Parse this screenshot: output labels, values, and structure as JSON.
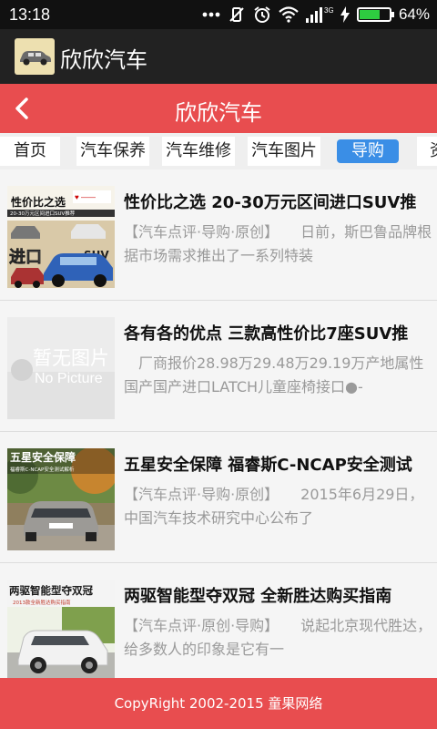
{
  "status_bar": {
    "time": "13:18",
    "network": "3G",
    "battery_percent": "64%",
    "battery_level": 0.64
  },
  "app": {
    "title": "欣欣汽车",
    "logo_icon": "car-logo-icon"
  },
  "nav": {
    "title": "欣欣汽车",
    "back_icon": "chevron-left-icon"
  },
  "tabs": [
    {
      "label": "首页",
      "active": false
    },
    {
      "label": "汽车保养",
      "active": false
    },
    {
      "label": "汽车维修",
      "active": false
    },
    {
      "label": "汽车图片",
      "active": false
    },
    {
      "label": "导购",
      "active": true
    },
    {
      "label": "资",
      "active": false
    }
  ],
  "articles": [
    {
      "title": "性价比之选 20-30万元区间进口SUV推",
      "summary": "【汽车点评·导购·原创】　　日前，斯巴鲁品牌根据市场需求推出了一系列特装",
      "thumb_caption": "性价比之选",
      "thumb_subcaption": "20-30万元区间进口SUV推荐",
      "thumb_overlay": "进口",
      "thumb_badge": "SUV"
    },
    {
      "title": "各有各的优点 三款高性价比7座SUV推",
      "summary": "　厂商报价28.98万29.48万29.19万产地属性国产国产进口LATCH儿童座椅接口●-",
      "thumb_caption": "暂无图片",
      "thumb_subcaption": "No Picture"
    },
    {
      "title": "五星安全保障 福睿斯C-NCAP安全测试",
      "summary": "【汽车点评·导购·原创】　　2015年6月29日，中国汽车技术研究中心公布了",
      "thumb_caption": "五星安全保障",
      "thumb_subcaption": "福睿斯C-NCAP安全测试解析"
    },
    {
      "title": "两驱智能型夺双冠 全新胜达购买指南",
      "summary": "【汽车点评·原创·导购】　　说起北京现代胜达，给多数人的印象是它有一",
      "thumb_caption": "两驱智能型夺双冠",
      "thumb_subcaption": "2013款全新胜达购买指南"
    }
  ],
  "footer": {
    "text": "CopyRight 2002-2015 童果网络"
  },
  "colors": {
    "accent_red": "#e84d4f",
    "active_tab_blue": "#3a8ee6",
    "dark_header": "#222222"
  }
}
